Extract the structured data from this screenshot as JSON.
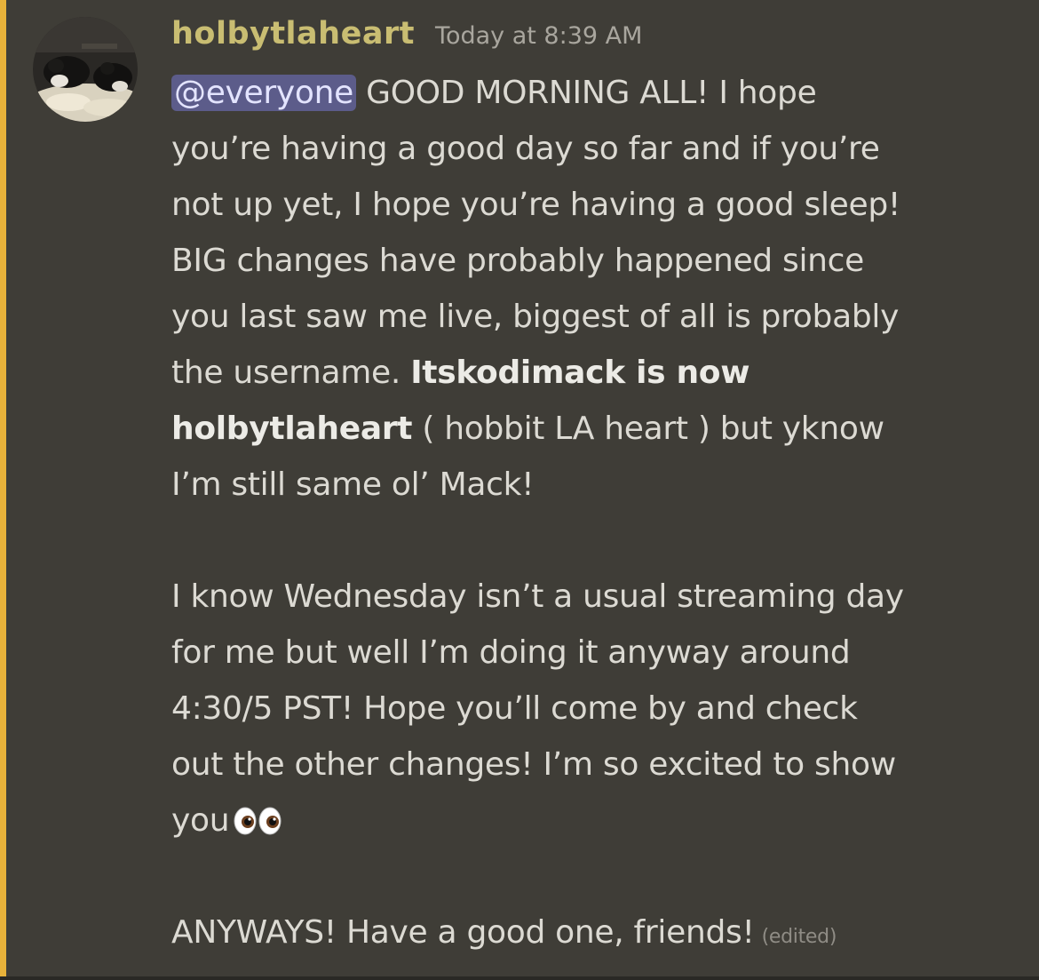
{
  "message": {
    "author": "holbytlaheart",
    "timestamp": "Today at 8:39 AM",
    "mention": "@everyone",
    "lines": {
      "l1_rest": " GOOD MORNING ALL!  I hope",
      "l2": "you’re having a good day so far and if you’re",
      "l3": "not up yet, I hope you’re having a good sleep!",
      "l4": "BIG changes have probably happened since",
      "l5": "you last saw me live, biggest of all is probably",
      "l6_a": "the username. ",
      "l6_bold": "Itskodimack is now",
      "l7_bold": "holbytlaheart",
      "l7_rest": " ( hobbit LA heart ) but yknow",
      "l8": "I’m still same ol’ Mack!",
      "l9": "I know Wednesday isn’t a usual streaming day",
      "l10": "for me but well I’m doing it anyway around",
      "l11": "4:30/5 PST! Hope you’ll come by and check",
      "l12": "out the other changes! I’m so excited to show",
      "l13": "you",
      "l14": "ANYWAYS! Have a good one, friends!"
    },
    "edited_label": "(edited)",
    "emoji": "eyes-emoji"
  },
  "colors": {
    "background": "#3f3d37",
    "mention_bar": "#e8b23a",
    "username": "#c9bd72",
    "mention_bg": "#5c5c8a"
  }
}
